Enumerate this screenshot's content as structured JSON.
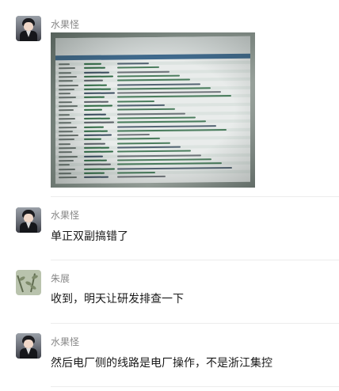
{
  "messages": [
    {
      "sender": "水果怪",
      "type": "image"
    },
    {
      "sender": "水果怪",
      "type": "text",
      "text": "单正双副搞错了"
    },
    {
      "sender": "朱展",
      "type": "text",
      "text": "收到，明天让研发排查一下"
    },
    {
      "sender": "水果怪",
      "type": "text",
      "text": "然后电厂侧的线路是电厂操作，不是浙江集控"
    }
  ],
  "colors": {
    "name": "#888888",
    "text": "#191919",
    "separator": "#ececec",
    "background": "#ffffff"
  }
}
